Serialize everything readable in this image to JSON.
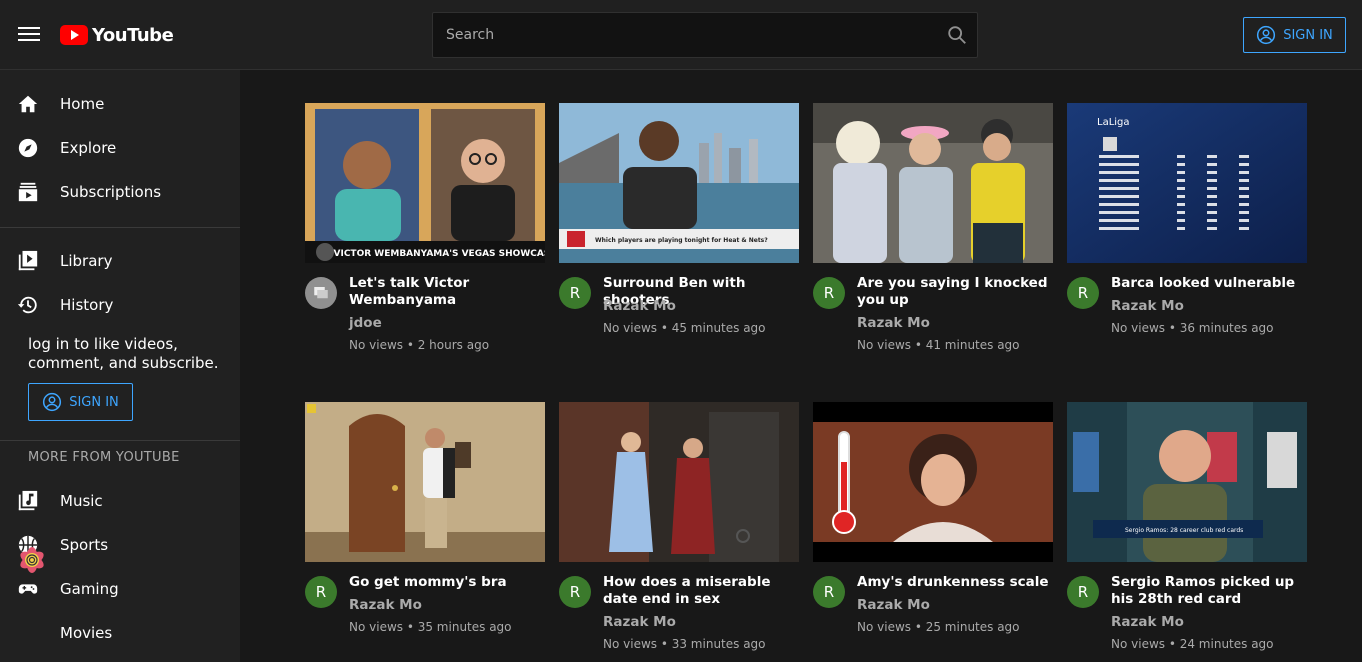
{
  "header": {
    "logo_text": "YouTube",
    "search_placeholder": "Search",
    "sign_in_label": "SIGN IN"
  },
  "sidebar": {
    "primary": [
      {
        "label": "Home",
        "icon": "home-icon"
      },
      {
        "label": "Explore",
        "icon": "compass-icon"
      },
      {
        "label": "Subscriptions",
        "icon": "subscriptions-icon"
      }
    ],
    "secondary": [
      {
        "label": "Library",
        "icon": "library-icon"
      },
      {
        "label": "History",
        "icon": "history-icon"
      }
    ],
    "login_prompt": "log in to like videos, comment, and subscribe.",
    "sign_in_label": "SIGN IN",
    "more_heading": "MORE FROM YOUTUBE",
    "more": [
      {
        "label": "Music",
        "icon": "music-icon"
      },
      {
        "label": "Sports",
        "icon": "sports-icon"
      },
      {
        "label": "Gaming",
        "icon": "gaming-icon"
      },
      {
        "label": "Movies",
        "icon": "movies-icon"
      }
    ]
  },
  "videos": [
    {
      "title": "Let's talk Victor Wembanyama",
      "channel": "jdoe",
      "meta": "No views • 2 hours ago",
      "avatar": "",
      "overlay": "VICTOR WEMBANYAMA'S VEGAS SHOWCASE"
    },
    {
      "title": "Surround Ben with shooters",
      "channel": "Razak Mo",
      "meta": "No views • 45 minutes ago",
      "avatar": "R",
      "overlay": "Which players are playing tonight for Heat & Nets?"
    },
    {
      "title": "Are you saying I knocked you up",
      "channel": "Razak Mo",
      "meta": "No views • 41 minutes ago",
      "avatar": "R"
    },
    {
      "title": "Barca looked vulnerable",
      "channel": "Razak Mo",
      "meta": "No views • 36 minutes ago",
      "avatar": "R",
      "overlay": "LaLiga"
    },
    {
      "title": "Go get mommy's bra",
      "channel": "Razak Mo",
      "meta": "No views • 35 minutes ago",
      "avatar": "R"
    },
    {
      "title": "How does a miserable date end in sex",
      "channel": "Razak Mo",
      "meta": "No views • 33 minutes ago",
      "avatar": "R"
    },
    {
      "title": "Amy's drunkenness scale",
      "channel": "Razak Mo",
      "meta": "No views • 25 minutes ago",
      "avatar": "R"
    },
    {
      "title": "Sergio Ramos picked up his 28th red card",
      "channel": "Razak Mo",
      "meta": "No views • 24 minutes ago",
      "avatar": "R",
      "overlay": "Sergio Ramos: 28 career club red cards"
    }
  ],
  "colors": {
    "accent": "#3ea6ff",
    "brand": "#ff0000",
    "avatar": "#3b7a2c"
  }
}
